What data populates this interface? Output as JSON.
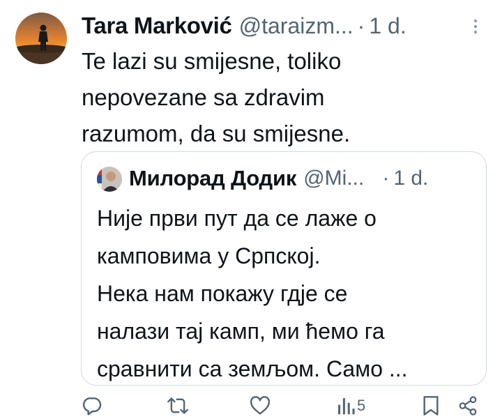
{
  "tweet": {
    "author_name": "Tara Marković",
    "handle": "@taraizm...",
    "separator": "·",
    "timestamp": "1 d.",
    "text": "Te lazi su smijesne, toliko\nnepovezane sa zdravim\nrazumom, da su smijesne."
  },
  "quoted_tweet": {
    "author_name": "Милорад Додик",
    "handle": "@Mi...",
    "separator": "·",
    "timestamp": "1 d.",
    "text": "Није први пут да се лаже о\nкамповима у Српској.\nНека нам покажу гдје се\nналази тај камп, ми ћемо га\nсравнити са земљом. Само ..."
  },
  "actions": {
    "views_count": "5",
    "icons": [
      "reply-icon",
      "retweet-icon",
      "like-icon",
      "views-icon",
      "bookmark-icon",
      "share-icon"
    ]
  },
  "colors": {
    "text": "#0f1419",
    "secondary": "#536471",
    "border": "#cfd9de",
    "icon": "#536471"
  }
}
